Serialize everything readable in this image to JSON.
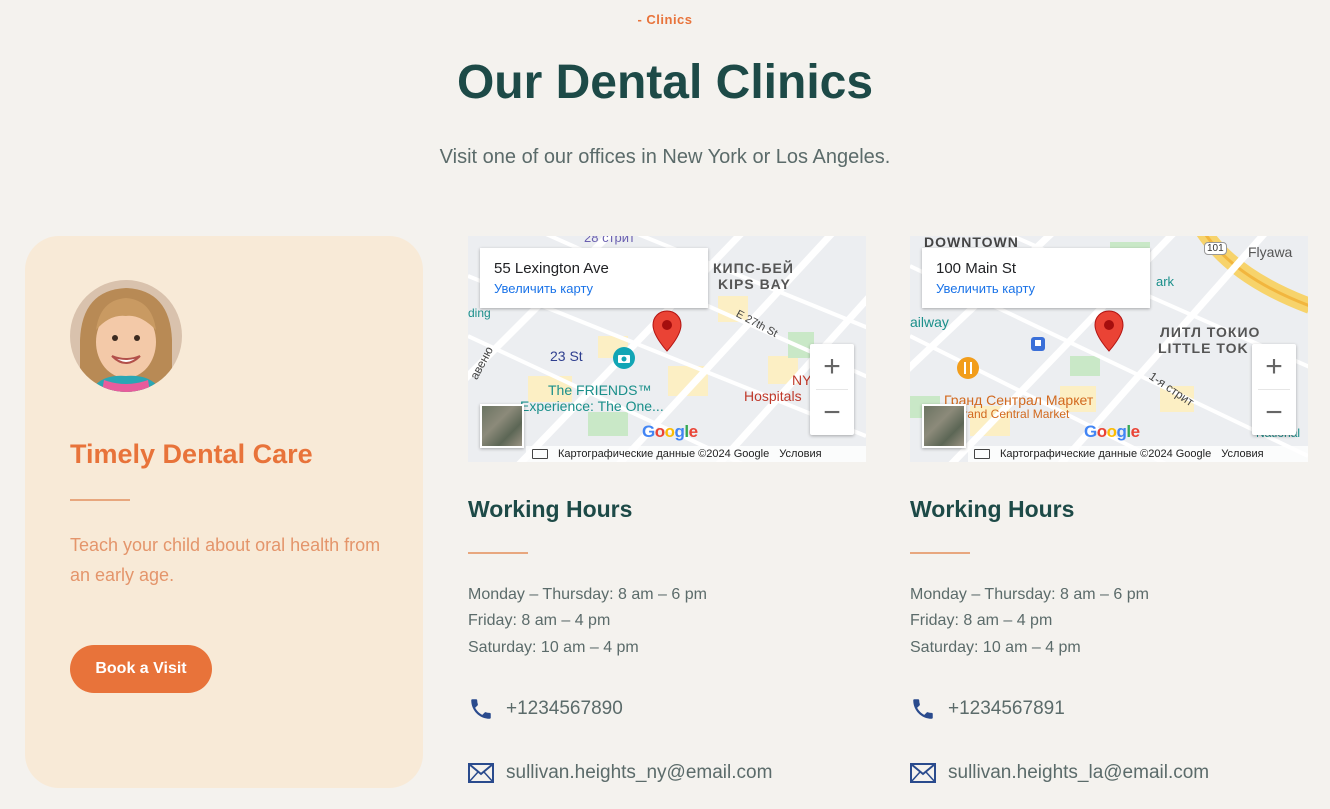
{
  "section": {
    "eyebrow": "- Clinics",
    "title": "Our Dental Clinics",
    "subtitle": "Visit one of our offices in New York or Los Angeles."
  },
  "card": {
    "title": "Timely Dental Care",
    "text": "Teach your child about oral health from an early age.",
    "button_label": "Book a Visit"
  },
  "clinics": [
    {
      "address": "55 Lexington Ave",
      "map_link": "Увеличить карту",
      "map_labels": [
        "28 стрит",
        "КИПС-БЕЙ",
        "KIPS BAY",
        "E 27th St",
        "23 St",
        "The FRIENDS™",
        "Experience: The One...",
        "NY",
        "Hospitals",
        "авеню",
        "ding"
      ],
      "map_footer": "Картографические данные ©2024 Google",
      "map_terms": "Условия",
      "hours_title": "Working Hours",
      "hours": [
        "Monday – Thursday: 8 am – 6 pm",
        "Friday: 8 am – 4 pm",
        "Saturday: 10 am – 4 pm"
      ],
      "phone": "+1234567890",
      "email": "sullivan.heights_ny@email.com"
    },
    {
      "address": "100 Main St",
      "map_link": "Увеличить карту",
      "map_labels": [
        "DOWNTOWN",
        "Flyawa",
        "ЛИТЛ ТОКИО",
        "LITTLE TOK",
        "ailway",
        "Гранд Сентрал Маркет",
        "Grand Central Market",
        "1-я стрит",
        "ark",
        "National",
        "101"
      ],
      "map_footer": "Картографические данные ©2024 Google",
      "map_terms": "Условия",
      "hours_title": "Working Hours",
      "hours": [
        "Monday – Thursday: 8 am – 6 pm",
        "Friday: 8 am – 4 pm",
        "Saturday: 10 am – 4 pm"
      ],
      "phone": "+1234567891",
      "email": "sullivan.heights_la@email.com"
    }
  ],
  "map_controls": {
    "zoom_in": "+",
    "zoom_out": "−",
    "google": [
      "G",
      "o",
      "o",
      "g",
      "l",
      "e"
    ]
  },
  "colors": {
    "accent": "#e8733a",
    "heading": "#1d4a47",
    "card_bg": "#f8ead7",
    "page_bg": "#f4f2ee"
  }
}
